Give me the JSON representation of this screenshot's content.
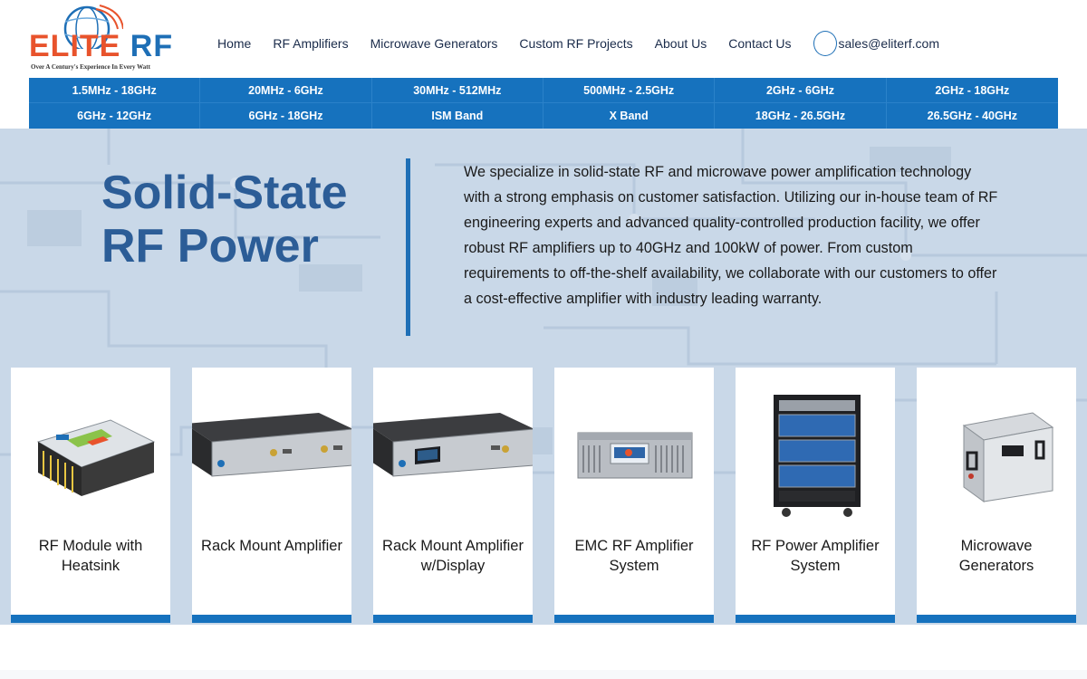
{
  "logo": {
    "word_left": "ELITE",
    "word_right": "RF",
    "tagline": "Over A Century's Experience In Every Watt"
  },
  "nav": {
    "links": [
      "Home",
      "RF Amplifiers",
      "Microwave Generators",
      "Custom RF Projects",
      "About Us",
      "Contact Us"
    ],
    "email": "sales@eliterf.com"
  },
  "bands": [
    "1.5MHz - 18GHz",
    "20MHz - 6GHz",
    "30MHz - 512MHz",
    "500MHz - 2.5GHz",
    "2GHz - 6GHz",
    "2GHz - 18GHz",
    "6GHz - 12GHz",
    "6GHz - 18GHz",
    "ISM Band",
    "X Band",
    "18GHz - 26.5GHz",
    "26.5GHz - 40GHz"
  ],
  "hero": {
    "title": "Solid-State RF Power",
    "description": "We specialize in solid-state RF and microwave power amplification technology with a strong emphasis on customer satisfaction. Utilizing our in-house team of RF engineering experts and advanced quality-controlled production facility, we offer robust RF amplifiers up to 40GHz and 100kW of power. From custom requirements to off-the-shelf availability, we collaborate with our customers to offer a cost-effective amplifier with industry leading warranty."
  },
  "products": [
    {
      "title": "RF Module with Heatsink"
    },
    {
      "title": "Rack Mount Amplifier"
    },
    {
      "title": "Rack Mount Amplifier w/Display"
    },
    {
      "title": "EMC RF Amplifier System"
    },
    {
      "title": "RF Power Amplifier System"
    },
    {
      "title": "Microwave Generators"
    }
  ],
  "colors": {
    "brand_blue": "#1672be",
    "brand_orange": "#e8532c",
    "title_blue": "#2c5d97"
  }
}
